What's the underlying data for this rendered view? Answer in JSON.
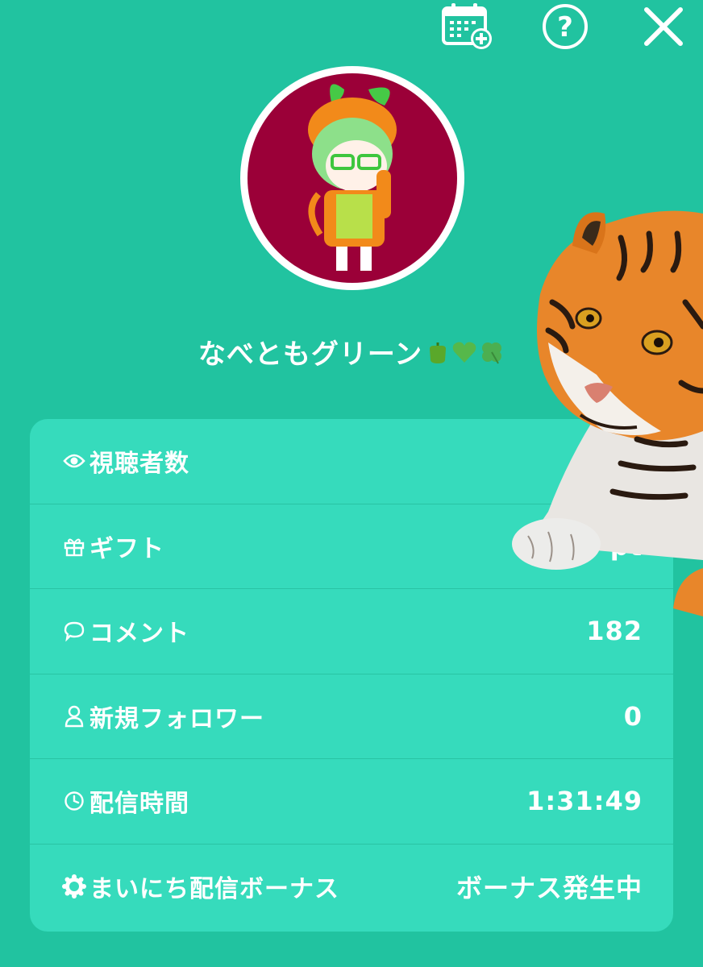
{
  "header": {
    "icons": [
      "calendar-add-icon",
      "help-icon",
      "close-icon"
    ]
  },
  "profile": {
    "username": "なべともグリーン",
    "username_emojis": "🫑💚🍀"
  },
  "stats": [
    {
      "icon": "eye-icon",
      "label": "視聴者数",
      "value": ""
    },
    {
      "icon": "gift-icon",
      "label": "ギフト",
      "value": "pt"
    },
    {
      "icon": "comment-icon",
      "label": "コメント",
      "value": "182"
    },
    {
      "icon": "person-icon",
      "label": "新規フォロワー",
      "value": "0"
    },
    {
      "icon": "clock-icon",
      "label": "配信時間",
      "value": "1:31:49"
    },
    {
      "icon": "sun-badge-icon",
      "label": "まいにち配信ボーナス",
      "value": "ボーナス発生中"
    }
  ],
  "colors": {
    "background": "#21c3a0",
    "card": "#36dbbc",
    "avatar_bg": "#9b0038",
    "text": "#ffffff"
  }
}
